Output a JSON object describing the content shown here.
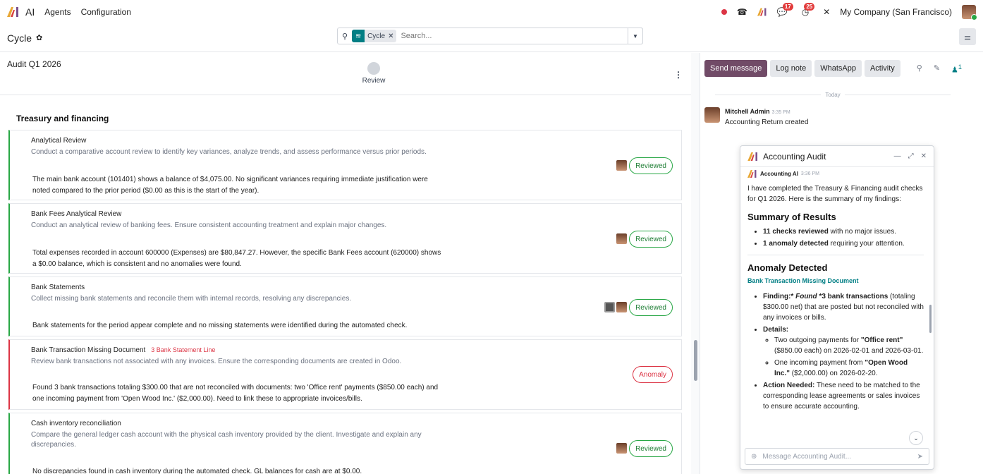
{
  "topbar": {
    "app_name": "AI",
    "nav": [
      "Agents",
      "Configuration"
    ],
    "badges": {
      "chat": "17",
      "activity": "25"
    },
    "company": "My Company (San Francisco)"
  },
  "controlpanel": {
    "breadcrumb": "Cycle",
    "search": {
      "facet": "Cycle",
      "placeholder": "Search..."
    }
  },
  "record": {
    "title": "Audit Q1 2026",
    "stage": "Review"
  },
  "section_title": "Treasury and financing",
  "cards": [
    {
      "title": "Analytical Review",
      "tag": "",
      "desc": "Conduct a comparative account review to identify key variances, analyze trends, and assess performance versus prior periods.",
      "result": "The main bank account (101401) shows a balance of $4,075.00. No significant variances requiring immediate justification were noted compared to the prior period ($0.00 as this is the start of the year).",
      "status": "Reviewed"
    },
    {
      "title": "Bank Fees Analytical Review",
      "tag": "",
      "desc": "Conduct an analytical review of banking fees. Ensure consistent accounting treatment and explain major changes.",
      "result": "Total expenses recorded in account 600000 (Expenses) are $80,847.27. However, the specific Bank Fees account (620000) shows a $0.00 balance, which is consistent and no anomalies were found.",
      "status": "Reviewed"
    },
    {
      "title": "Bank Statements",
      "tag": "",
      "desc": "Collect missing bank statements and reconcile them with internal records, resolving any discrepancies.",
      "result": "Bank statements for the period appear complete and no missing statements were identified during the automated check.",
      "status": "Reviewed"
    },
    {
      "title": "Bank Transaction Missing Document",
      "tag": "3 Bank Statement Line",
      "desc": "Review bank transactions not associated with any invoices. Ensure the corresponding documents are created in Odoo.",
      "result": "Found 3 bank transactions totaling $300.00 that are not reconciled with documents: two 'Office rent' payments ($850.00 each) and one incoming payment from 'Open Wood Inc.' ($2,000.00). Need to link these to appropriate invoices/bills.",
      "status": "Anomaly"
    },
    {
      "title": "Cash inventory reconciliation",
      "tag": "",
      "desc": "Compare the general ledger cash account with the physical cash inventory provided by the client. Investigate and explain any discrepancies.",
      "result": "No discrepancies found in cash inventory during the automated check. GL balances for cash are at $0.00.",
      "status": "Reviewed"
    }
  ],
  "chatter": {
    "buttons": [
      "Send message",
      "Log note",
      "WhatsApp",
      "Activity"
    ],
    "followers": "1",
    "divider": "Today",
    "message": {
      "author": "Mitchell Admin",
      "time": "3:35 PM",
      "text": "Accounting Return created"
    }
  },
  "popup": {
    "title": "Accounting Audit",
    "author": "Accounting AI",
    "time": "3:36 PM",
    "intro": "I have completed the Treasury & Financing audit checks for Q1 2026. Here is the summary of my findings:",
    "h_summary": "Summary of Results",
    "summary": [
      {
        "bold": "11 checks reviewed",
        "rest": " with no major issues."
      },
      {
        "bold": "1 anomaly detected",
        "rest": " requiring your attention."
      }
    ],
    "h_anomaly": "Anomaly Detected",
    "anomaly_sub": "Bank Transaction Missing Document",
    "finding_label": "Finding:*",
    "finding_em": "Found",
    "finding_bold": "*3 bank transactions",
    "finding_rest": " (totaling $300.00 net) that are posted but not reconciled with any invoices or bills.",
    "details_label": "Details:",
    "detail1_pre": "Two outgoing payments for ",
    "detail1_bold": "\"Office rent\"",
    "detail1_rest": " ($850.00 each) on 2026-02-01 and 2026-03-01.",
    "detail2_pre": "One incoming payment from ",
    "detail2_bold": "\"Open Wood Inc.\"",
    "detail2_rest": " ($2,000.00) on 2026-02-20.",
    "action_label": "Action Needed:",
    "action_rest": " These need to be matched to the corresponding lease agreements or sales invoices to ensure accurate accounting.",
    "input_placeholder": "Message Accounting Audit..."
  }
}
